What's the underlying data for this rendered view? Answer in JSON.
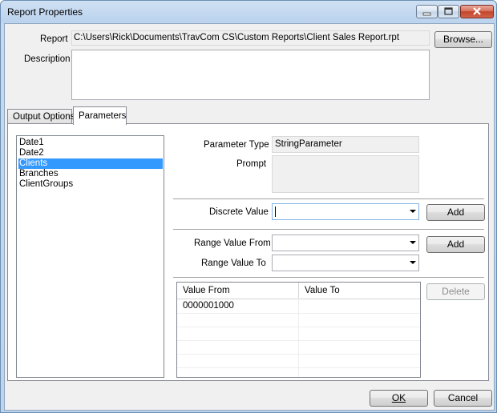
{
  "window": {
    "title": "Report Properties"
  },
  "report": {
    "report_label": "Report",
    "report_path": "C:\\Users\\Rick\\Documents\\TravCom CS\\Custom Reports\\Client Sales Report.rpt",
    "browse_label": "Browse...",
    "description_label": "Description",
    "description_value": ""
  },
  "tabs": [
    {
      "label": "Output Options",
      "active": false
    },
    {
      "label": "Parameters",
      "active": true
    }
  ],
  "parameters": {
    "list": [
      "Date1",
      "Date2",
      "Clients",
      "Branches",
      "ClientGroups"
    ],
    "selected": "Clients",
    "type_label": "Parameter Type",
    "type_value": "StringParameter",
    "prompt_label": "Prompt",
    "prompt_value": "",
    "discrete_label": "Discrete Value",
    "discrete_value": "",
    "add_label": "Add",
    "range_from_label": "Range Value From",
    "range_to_label": "Range Value To",
    "range_add_label": "Add",
    "delete_label": "Delete",
    "grid": {
      "columns": [
        "Value From",
        "Value To"
      ],
      "rows": [
        [
          "0000001000",
          ""
        ]
      ]
    }
  },
  "footer": {
    "ok_label": "OK",
    "cancel_label": "Cancel"
  },
  "colors": {
    "selection": "#3399ff",
    "title_gradient": "#bcd3ee",
    "close_button": "#c2452c"
  }
}
